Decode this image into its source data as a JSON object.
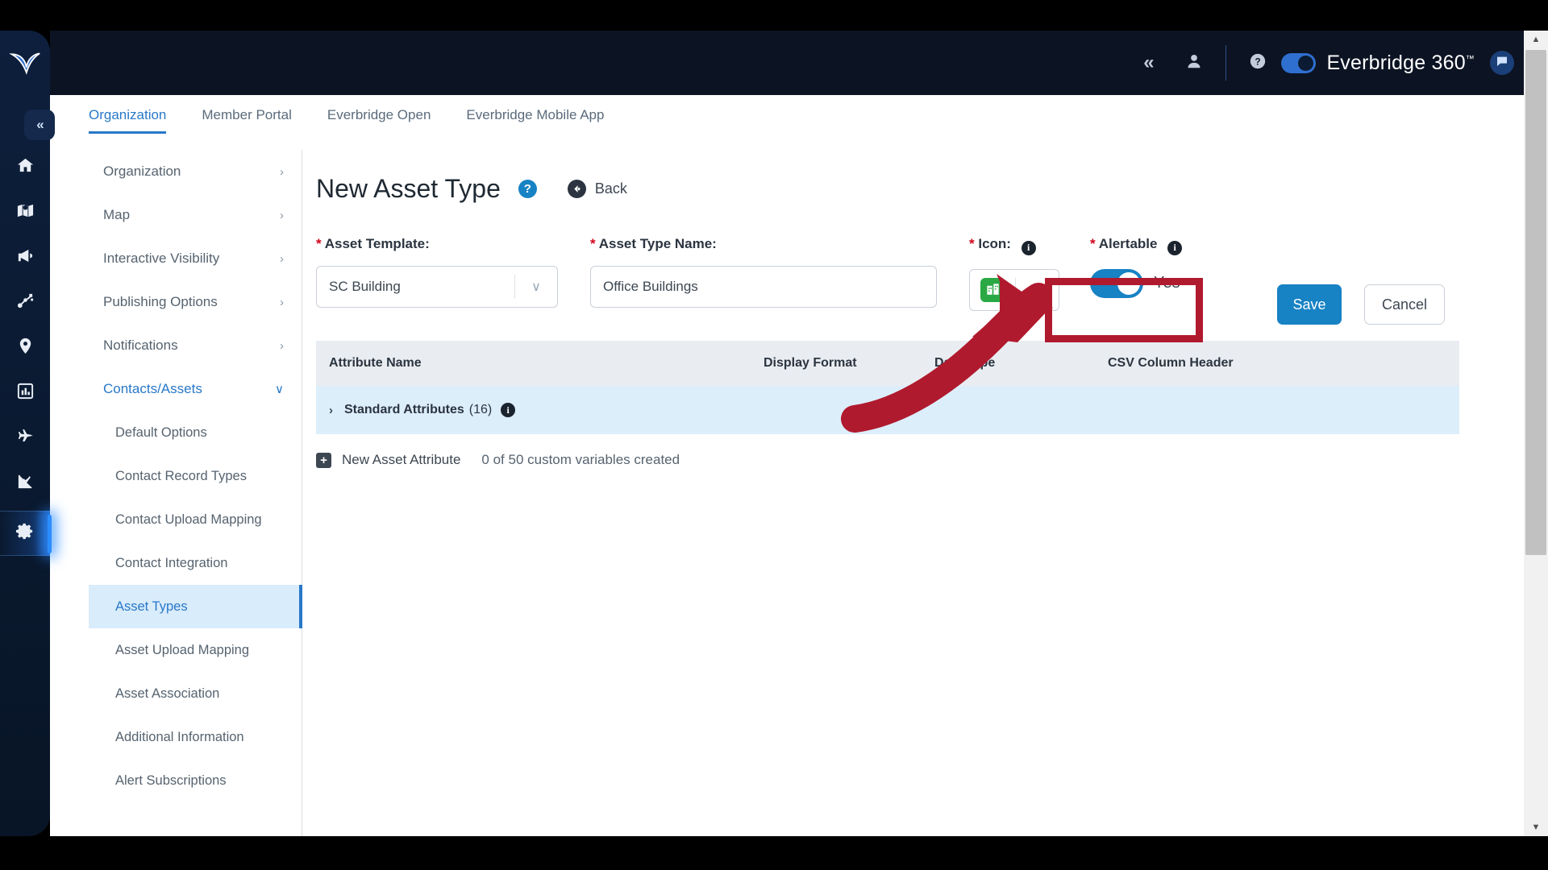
{
  "brand": {
    "name": "Everbridge 360",
    "tm": "™",
    "toggle_color": "#2f6fd0"
  },
  "rail": {
    "collapse_label": "«",
    "items": [
      {
        "name": "home-icon",
        "label": "Home"
      },
      {
        "name": "map-icon",
        "label": "Map"
      },
      {
        "name": "megaphone-icon",
        "label": "Notifications"
      },
      {
        "name": "incident-flow-icon",
        "label": "Incidents"
      },
      {
        "name": "location-pin-icon",
        "label": "Locations"
      },
      {
        "name": "reports-icon",
        "label": "Reports"
      },
      {
        "name": "travel-plane-icon",
        "label": "Travel"
      },
      {
        "name": "analytics-icon",
        "label": "Analytics"
      },
      {
        "name": "settings-gear-icon",
        "label": "Settings",
        "active": true
      }
    ]
  },
  "header": {
    "collapse_icon": "«",
    "user_icon": "user-icon",
    "help_icon": "help-icon",
    "chat_icon": "chat-icon"
  },
  "tabs": [
    {
      "label": "Organization",
      "active": true
    },
    {
      "label": "Member Portal",
      "active": false
    },
    {
      "label": "Everbridge Open",
      "active": false
    },
    {
      "label": "Everbridge Mobile App",
      "active": false
    }
  ],
  "leftnav": {
    "groups": [
      {
        "label": "Organization",
        "state": "collapsed"
      },
      {
        "label": "Map",
        "state": "collapsed"
      },
      {
        "label": "Interactive Visibility",
        "state": "collapsed"
      },
      {
        "label": "Publishing Options",
        "state": "collapsed"
      },
      {
        "label": "Notifications",
        "state": "collapsed"
      },
      {
        "label": "Contacts/Assets",
        "state": "expanded"
      }
    ],
    "sub_items": [
      {
        "label": "Default Options",
        "selected": false
      },
      {
        "label": "Contact Record Types",
        "selected": false
      },
      {
        "label": "Contact Upload Mapping",
        "selected": false
      },
      {
        "label": "Contact Integration",
        "selected": false
      },
      {
        "label": "Asset Types",
        "selected": true
      },
      {
        "label": "Asset Upload Mapping",
        "selected": false
      },
      {
        "label": "Asset Association",
        "selected": false
      },
      {
        "label": "Additional Information",
        "selected": false
      },
      {
        "label": "Alert Subscriptions",
        "selected": false
      }
    ],
    "chevron_collapsed": "›",
    "chevron_expanded": "∨"
  },
  "page": {
    "title": "New Asset Type",
    "help_glyph": "?",
    "back_label": "Back"
  },
  "form": {
    "asset_template": {
      "label": "Asset Template:",
      "required_mark": "*",
      "value": "SC Building",
      "caret": "∨"
    },
    "asset_type_name": {
      "label": "Asset Type Name:",
      "required_mark": "*",
      "value": "Office Buildings",
      "placeholder": "Asset Type Name"
    },
    "icon": {
      "label": "Icon:",
      "required_mark": "*",
      "info": "i",
      "swatch_color": "#2aa844",
      "swatch_icon": "building-icon"
    },
    "alertable": {
      "label": "Alertable",
      "required_mark": "*",
      "info": "i",
      "toggle_state": "Yes",
      "toggle_on": true,
      "toggle_color": "#1782c4"
    },
    "save_label": "Save",
    "cancel_label": "Cancel"
  },
  "table": {
    "columns": [
      "Attribute Name",
      "Display Format",
      "Data Type",
      "CSV Column Header"
    ],
    "rows": [
      {
        "chevron": "›",
        "label": "Standard Attributes",
        "count": "(16)",
        "info": "i"
      }
    ]
  },
  "footer_actions": {
    "plus": "+",
    "new_attribute_label": "New Asset Attribute",
    "custom_variables_meta": "0 of 50 custom variables created"
  },
  "annotation": {
    "highlight_color": "#b01a2e",
    "shape": "arrow-pointing-to-alertable-toggle"
  },
  "scrollbar": {
    "up_arrow": "▲",
    "down_arrow": "▼"
  }
}
